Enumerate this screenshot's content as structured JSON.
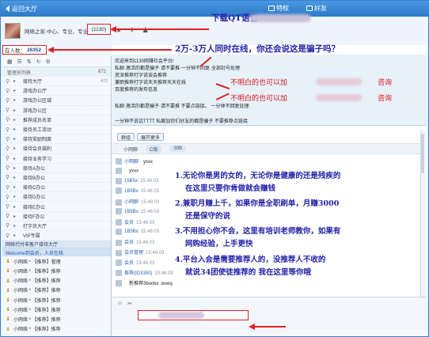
{
  "titlebar": {
    "back_label": "返回大厅",
    "tab1": "特权",
    "tab2": "好友"
  },
  "profile": {
    "room_name": "网络之家-中心、专业、专业",
    "room_code": "(1130)"
  },
  "online_count": {
    "label": "在人数：",
    "value": "26352"
  },
  "sidebar": {
    "header_left": "管理员列表",
    "header_right": "672",
    "items": [
      {
        "name": "接待大厅",
        "n": "472"
      },
      {
        "name": "游戏办公厅",
        "n": ""
      },
      {
        "name": "游戏办公区域",
        "n": ""
      },
      {
        "name": "游戏办公区",
        "n": ""
      },
      {
        "name": "推荐成员名单",
        "n": ""
      },
      {
        "name": "接待员工流动",
        "n": ""
      },
      {
        "name": "接待奖励制度",
        "n": ""
      },
      {
        "name": "接待会员福利",
        "n": ""
      },
      {
        "name": "接待业务学习",
        "n": ""
      },
      {
        "name": "接待A办公",
        "n": ""
      },
      {
        "name": "接待B办公",
        "n": ""
      },
      {
        "name": "接待C办公",
        "n": ""
      },
      {
        "name": "接待D办公",
        "n": ""
      },
      {
        "name": "接待E办公",
        "n": ""
      },
      {
        "name": "接待F办公",
        "n": ""
      },
      {
        "name": "打字员大厅",
        "n": ""
      },
      {
        "name": "VIP专属",
        "n": ""
      }
    ],
    "section_label": "网络代付非客户接待大厅",
    "list_label": "Welcome到会员，人员在线",
    "users": [
      "小网络 * 【推荐】管理",
      "小网络 * 【推荐】推荐",
      "小网络 * 【推荐】推荐",
      "小网络 * 【推荐】推荐",
      "小网络 * 【推荐】推荐",
      "小网络 * 【推荐】推荐",
      "小网络 * 【推荐】推荐",
      "小网络 * 【推荐】推荐"
    ]
  },
  "notice": {
    "lines": [
      "欢迎来到1130网赚社会平台!",
      "私聊·激活的都是骗子·请不要推·一分钟不回复·全部封号处理",
      "资深推荐打字说谈会推荐",
      "兼职推荐打字说天天推荐天天在线",
      "百度推荐的发布信息",
      "私聊·激活的都是骗子·请不要推 不要点链接。        一分钟不回复处理·",
      "一分钟不说话TTTT 私聊加你们好友的都是骗子 不要推荐点链接"
    ]
  },
  "tabs": {
    "tab1": "群组",
    "tab2": "展开更多"
  },
  "sysbar": {
    "label": "小网聊",
    "pill1": "C级",
    "pill2": "30B"
  },
  "messages": [
    {
      "name": "小网聊",
      "time": "",
      "text": "yxxx"
    },
    {
      "name": "",
      "time": "",
      "text": "yxxx"
    },
    {
      "name": "15B5x",
      "time": "15:46:03",
      "text": ""
    },
    {
      "name": "1B5Bx",
      "time": "15:46:03",
      "text": ""
    },
    {
      "name": "小网聊",
      "time": "15:46:03",
      "text": ""
    },
    {
      "name": "1B5Bx",
      "time": "15:46:03",
      "text": ""
    },
    {
      "name": "会员",
      "time": "15:46:03",
      "text": ""
    },
    {
      "name": "1B5Bx",
      "time": "15:46:03",
      "text": ""
    },
    {
      "name": "会员",
      "time": "15:46:03",
      "text": ""
    },
    {
      "name": "会员管理",
      "time": "15:46:03",
      "text": ""
    },
    {
      "name": "会员",
      "time": "15:46:03",
      "text": ""
    },
    {
      "name": "推荐(ID3350)",
      "time": "15:46:03",
      "text": ""
    },
    {
      "name": "",
      "time": "",
      "text": "新推荐3bookx .wxeq"
    }
  ],
  "annotations": {
    "top": "下载QT语音",
    "line2": "2万-3万人同时在线，你还会说这是骗子吗？",
    "qq_prefix": "不明白的也可以加",
    "qq_suffix": "咨询",
    "points": [
      "1.无论你是男的女的，无论你是健康的还是残疾的",
      "在这里只要你肯做就会赚钱",
      "2.兼职月赚上千，如果你是全职刷单，月赚3000",
      "还是保守的说",
      "3.不用担心你不会，这里有培训老师教你，如果有",
      "网购经验，上手更快",
      "4.平台入会是需要推荐人的，没推荐人不收的",
      "就说34团使徒推荐的 我在这里等你哦"
    ]
  },
  "colors": {
    "titlebar": "#2c79c8",
    "annotation_blue": "#2323a8",
    "annotation_red": "#d81919",
    "highlight_border": "#dd2222"
  }
}
